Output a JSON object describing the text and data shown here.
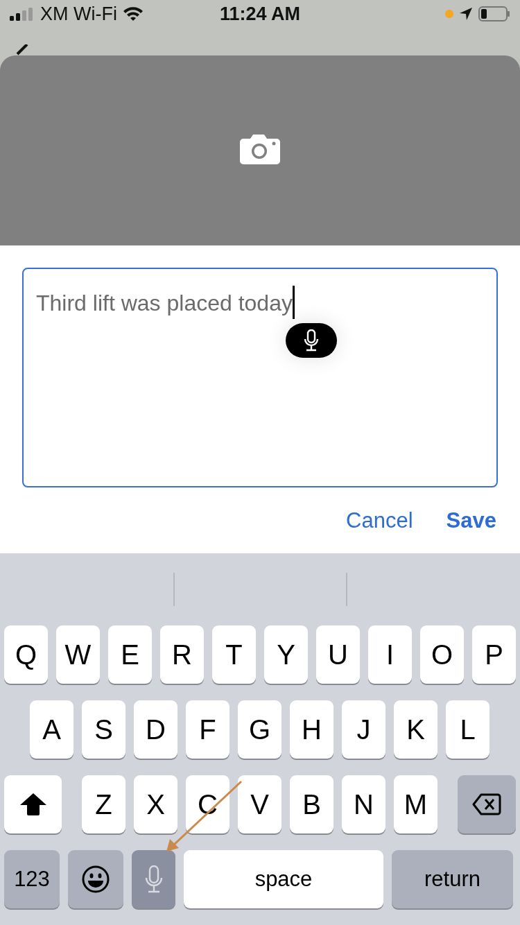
{
  "status_bar": {
    "carrier": "XM Wi-Fi",
    "time": "11:24 AM"
  },
  "note": {
    "text": "Third lift was placed today"
  },
  "actions": [
    {
      "label": "Cancel",
      "kind": "plain"
    },
    {
      "label": "Save",
      "kind": "primary"
    }
  ],
  "keyboard": {
    "rows": [
      [
        "Q",
        "W",
        "E",
        "R",
        "T",
        "Y",
        "U",
        "I",
        "O",
        "P"
      ],
      [
        "A",
        "S",
        "D",
        "F",
        "G",
        "H",
        "J",
        "K",
        "L"
      ],
      [
        "Z",
        "X",
        "C",
        "V",
        "B",
        "N",
        "M"
      ]
    ],
    "numbers_key": "123",
    "space_key": "space",
    "return_key": "return"
  }
}
